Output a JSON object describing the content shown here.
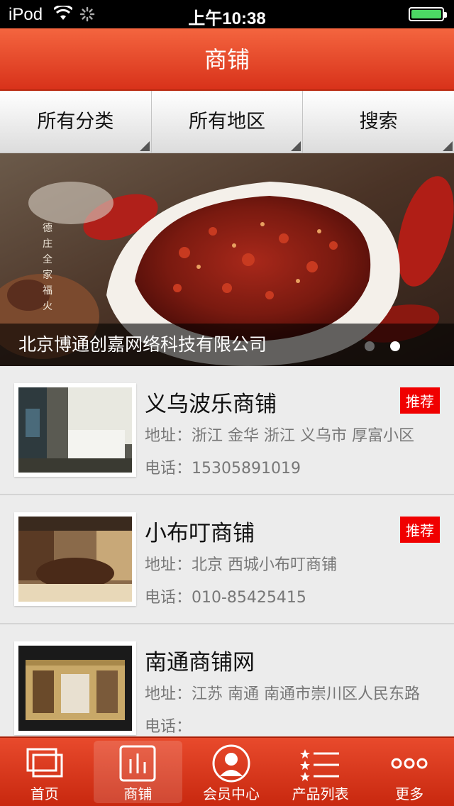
{
  "status_bar": {
    "carrier": "iPod",
    "time": "上午10:38"
  },
  "nav": {
    "title": "商铺"
  },
  "filters": [
    {
      "label": "所有分类"
    },
    {
      "label": "所有地区"
    },
    {
      "label": "搜索"
    }
  ],
  "banner": {
    "caption": "北京博通创嘉网络科技有限公司",
    "slide_count": 2,
    "active_slide": 2
  },
  "shops": [
    {
      "name": "义乌波乐商铺",
      "badge": "推荐",
      "address": "地址：浙江 金华 浙江 义乌市 厚富小区",
      "phone": "电话：15305891019"
    },
    {
      "name": "小布叮商铺",
      "badge": "推荐",
      "address": "地址：北京 西城小布叮商铺",
      "phone": "电话：010-85425415"
    },
    {
      "name": "南通商铺网",
      "badge": "",
      "address": "地址：江苏 南通 南通市崇川区人民东路",
      "phone": "电话："
    }
  ],
  "tabs": [
    {
      "label": "首页",
      "icon": "home-windows-icon"
    },
    {
      "label": "商铺",
      "icon": "bar-chart-icon"
    },
    {
      "label": "会员中心",
      "icon": "user-icon"
    },
    {
      "label": "产品列表",
      "icon": "star-list-icon"
    },
    {
      "label": "更多",
      "icon": "more-dots-icon"
    }
  ],
  "colors": {
    "nav_red": "#e8462a",
    "badge_red": "#f00000",
    "battery_green": "#4cd964"
  }
}
